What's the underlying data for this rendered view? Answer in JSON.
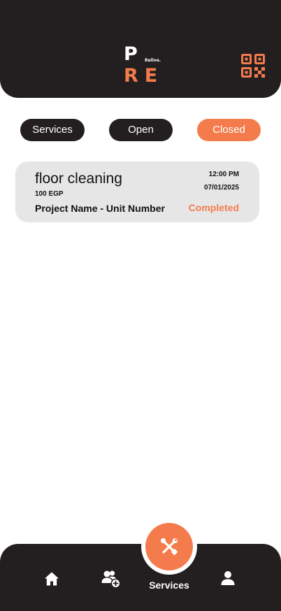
{
  "colors": {
    "dark": "#231f20",
    "accent": "#f47c4c",
    "card_bg": "#e6e6e6",
    "white": "#ffffff"
  },
  "header": {
    "logo": {
      "top": "P",
      "small": "Relive.",
      "bottom": "RE"
    },
    "qr_icon": "qr-code-icon"
  },
  "filters": [
    {
      "label": "Services",
      "active": false
    },
    {
      "label": "Open",
      "active": false
    },
    {
      "label": "Closed",
      "active": true
    }
  ],
  "services": [
    {
      "title": "floor cleaning",
      "price": "100 EGP",
      "project": "Project Name - Unit Number",
      "time": "12:00 PM",
      "date": "07/01/2025",
      "status": "Completed"
    }
  ],
  "bottom_nav": {
    "items": [
      {
        "icon": "home-icon"
      },
      {
        "icon": "add-user-icon"
      },
      {
        "icon": "tools-icon",
        "label": "Services",
        "active": true
      },
      {
        "icon": "profile-icon"
      }
    ]
  }
}
